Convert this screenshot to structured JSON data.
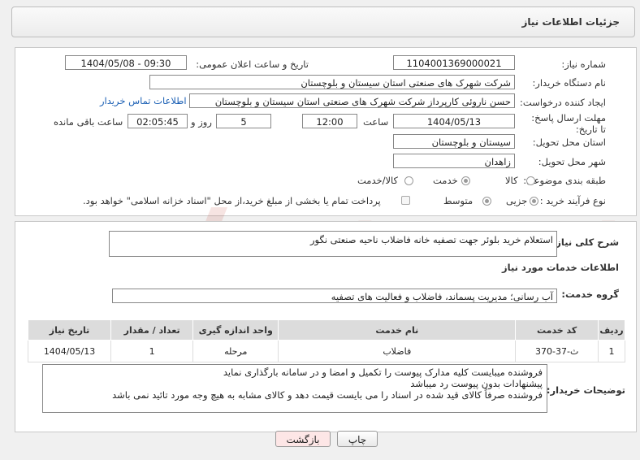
{
  "header": {
    "title": "جزئیات اطلاعات نیاز"
  },
  "fields": {
    "need_number_label": "شماره نیاز:",
    "need_number": "1104001369000021",
    "announce_label": "تاریخ و ساعت اعلان عمومی:",
    "announce_value": "1404/05/08 - 09:30",
    "buyer_org_label": "نام دستگاه خریدار:",
    "buyer_org": "شرکت شهرک های صنعتی استان سیستان و بلوچستان",
    "requester_label": "ایجاد کننده درخواست:",
    "requester": "حسن ناروئی کارپرداز شرکت شهرک های صنعتی استان سیستان و بلوچستان",
    "contact_link": "اطلاعات تماس خریدار",
    "deadline_label": "مهلت ارسال پاسخ: تا تاریخ:",
    "deadline_date": "1404/05/13",
    "hour_label": "ساعت",
    "deadline_hour": "12:00",
    "days_value": "5",
    "days_label": "روز و",
    "remaining_value": "02:05:45",
    "remaining_label": "ساعت باقی مانده",
    "province_label": "استان محل تحویل:",
    "province": "سیستان و بلوچستان",
    "city_label": "شهر محل تحویل:",
    "city": "زاهدان",
    "category_label": "طبقه بندی موضوعی:",
    "category_options": [
      "کالا",
      "خدمت",
      "کالا/خدمت"
    ],
    "category_selected": "خدمت",
    "process_label": "نوع فرآیند خرید :",
    "process_options": [
      "جزیی",
      "متوسط"
    ],
    "process_selected": "جزیی",
    "payment_text": "پرداخت تمام یا بخشی از مبلغ خرید،از محل \"اسناد خزانه اسلامی\" خواهد بود."
  },
  "description": {
    "label": "شرح کلی نیاز:",
    "text": "استعلام خرید بلوئر جهت تصفیه خانه فاضلاب ناحیه صنعتی نگور"
  },
  "services": {
    "section_title": "اطلاعات خدمات مورد نیاز",
    "group_label": "گروه خدمت:",
    "group_value": "آب رسانی؛ مدیریت پسماند، فاضلاب و فعالیت های تصفیه",
    "columns": [
      "ردیف",
      "کد خدمت",
      "نام خدمت",
      "واحد اندازه گیری",
      "تعداد / مقدار",
      "تاریخ نیاز"
    ],
    "rows": [
      [
        "1",
        "ث-37-370",
        "فاضلاب",
        "مرحله",
        "1",
        "1404/05/13"
      ]
    ]
  },
  "notes": {
    "label": "توضیحات خریدار:",
    "lines": [
      "فروشنده میبایست کلیه مدارک پیوست را تکمیل و امضا و در سامانه بارگذاری نماید",
      "پیشنهادات بدون پیوست رد میباشد",
      "فروشنده صرفاً کالای قید شده در اسناد را می بایست قیمت دهد و کالای مشابه به هیچ وجه مورد تائید نمی باشد"
    ]
  },
  "buttons": {
    "print": "چاپ",
    "back": "بازگشت"
  },
  "colors": {
    "back_button_bg": "#fde6e6",
    "link": "#1a5fb4"
  }
}
